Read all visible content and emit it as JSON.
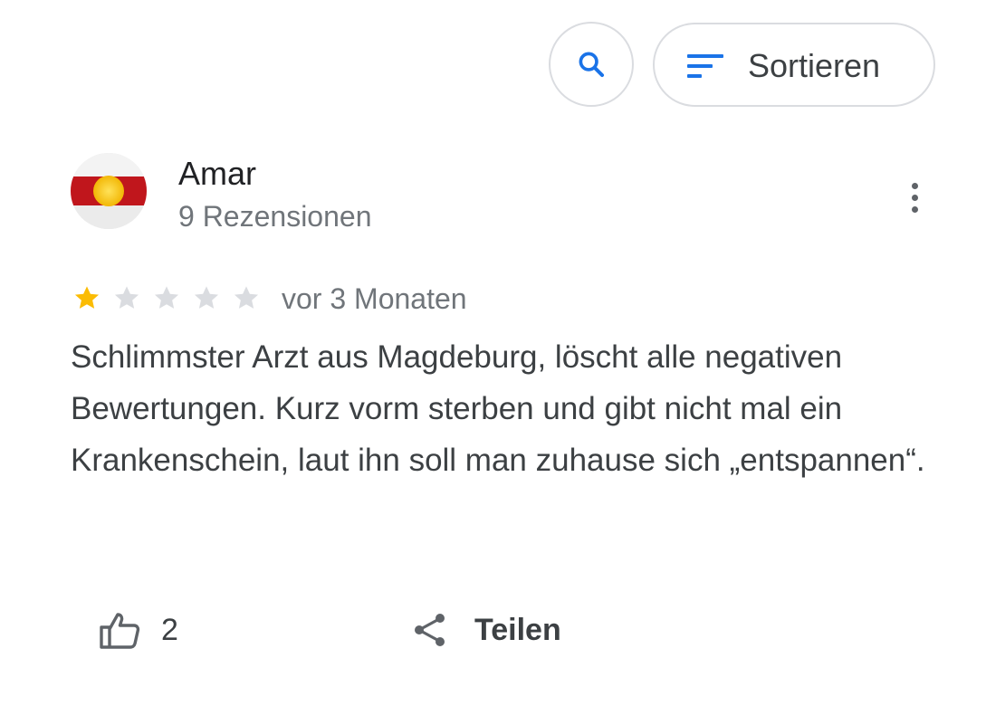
{
  "toolbar": {
    "search_icon": "search-icon",
    "sort_icon": "sort-icon",
    "sort_label": "Sortieren"
  },
  "review": {
    "author_name": "Amar",
    "author_meta": "9 Rezensionen",
    "rating": 1,
    "rating_max": 5,
    "date": "vor 3 Monaten",
    "text": "Schlimmster Arzt aus Magdeburg, löscht alle negativen Bewertungen. Kurz vorm sterben und gibt nicht mal ein Krankenschein, laut ihn soll man zuhause sich „entspannen“.",
    "likes": "2",
    "share_label": "Teilen"
  },
  "colors": {
    "accent_blue": "#1a73e8",
    "star_filled": "#fbbc04",
    "star_empty": "#dadce0",
    "text_secondary": "#70757a",
    "border": "#dadce0"
  }
}
